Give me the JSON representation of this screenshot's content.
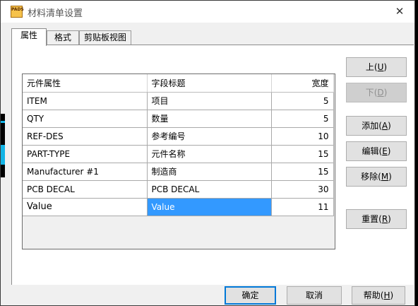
{
  "window": {
    "title": "材料清单设置",
    "icon_text": "PADS",
    "close_glyph": "✕"
  },
  "tabs": [
    {
      "label": "属性",
      "active": true
    },
    {
      "label": "格式",
      "active": false
    },
    {
      "label": "剪贴板视图",
      "active": false
    }
  ],
  "table": {
    "headers": [
      "元件属性",
      "字段标题",
      "宽度"
    ],
    "rows": [
      {
        "attr": "ITEM",
        "title": "项目",
        "width": "5"
      },
      {
        "attr": "QTY",
        "title": "数量",
        "width": "5"
      },
      {
        "attr": "REF-DES",
        "title": "参考编号",
        "width": "10"
      },
      {
        "attr": "PART-TYPE",
        "title": "元件名称",
        "width": "15"
      },
      {
        "attr": "Manufacturer #1",
        "title": "制造商",
        "width": "15"
      },
      {
        "attr": "PCB DECAL",
        "title": "PCB DECAL",
        "width": "30"
      },
      {
        "attr": "Value",
        "title": "Value",
        "width": "11",
        "selected_column": "title"
      }
    ]
  },
  "side_buttons": {
    "up": {
      "label": "上(",
      "key": "U",
      "suffix": ")",
      "enabled": true
    },
    "down": {
      "label": "下(",
      "key": "D",
      "suffix": ")",
      "enabled": false
    },
    "add": {
      "label": "添加(",
      "key": "A",
      "suffix": ")",
      "enabled": true
    },
    "edit": {
      "label": "编辑(",
      "key": "E",
      "suffix": ")",
      "enabled": true
    },
    "remove": {
      "label": "移除(",
      "key": "M",
      "suffix": ")",
      "enabled": true
    },
    "reset": {
      "label": "重置(",
      "key": "R",
      "suffix": ")",
      "enabled": true
    }
  },
  "footer_buttons": {
    "ok": "确定",
    "cancel": "取消",
    "help": {
      "label": "帮助(",
      "key": "H",
      "suffix": ")"
    }
  },
  "colors": {
    "selection": "#3399ff",
    "default_button_border": "#0078d7",
    "accent_strip": "#12b4e6"
  }
}
